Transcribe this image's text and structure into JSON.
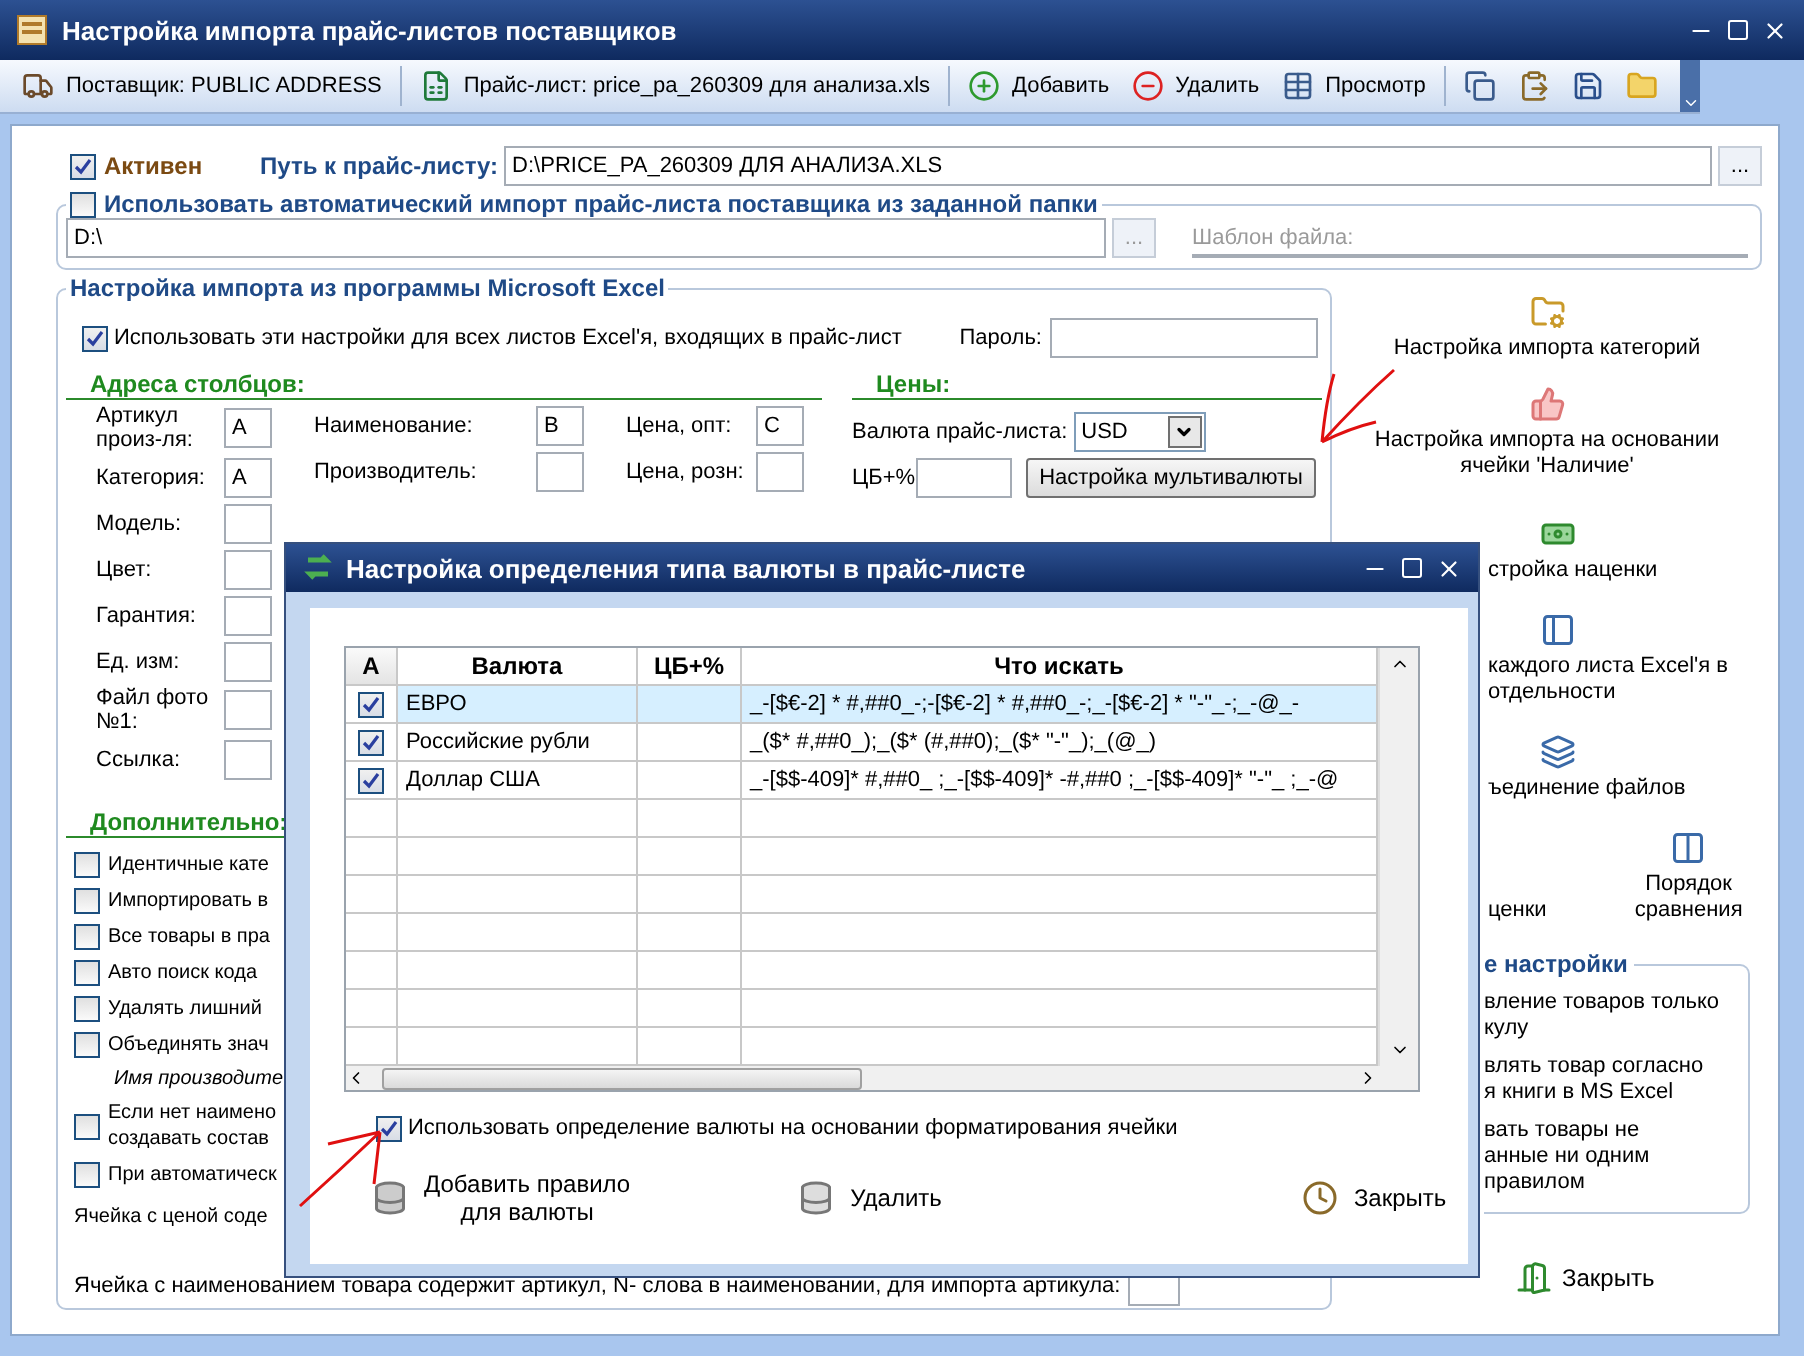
{
  "window": {
    "title": "Настройка импорта прайс-листов поставщиков"
  },
  "toolbar": [
    {
      "kind": "supplier",
      "label": "Поставщик: PUBLIC ADDRESS"
    },
    {
      "kind": "excel",
      "label": "Прайс-лист: price_pa_260309 для анализа.xls"
    },
    {
      "kind": "add",
      "label": "Добавить"
    },
    {
      "kind": "delete",
      "label": "Удалить"
    },
    {
      "kind": "view",
      "label": "Просмотр"
    },
    {
      "kind": "copy"
    },
    {
      "kind": "paste"
    },
    {
      "kind": "save"
    },
    {
      "kind": "folder"
    }
  ],
  "active": {
    "label": "Активен",
    "checked": true
  },
  "path": {
    "label": "Путь к прайс-листу:",
    "value": "D:\\PRICE_PA_260309 ДЛЯ АНАЛИЗА.XLS",
    "button": "..."
  },
  "auto_import": {
    "label": "Использовать автоматический импорт прайс-листа поставщика из заданной папки",
    "checked": false,
    "folder": "D:\\",
    "button": "...",
    "template_label": "Шаблон файла:"
  },
  "excel": {
    "title": "Настройка импорта из программы Microsoft Excel",
    "all_sheets": {
      "label": "Использовать эти настройки для всех листов Excel'я, входящих в прайс-лист",
      "checked": true
    },
    "password_label": "Пароль:",
    "columns_title": "Адреса столбцов:",
    "address_columns": [
      {
        "fields": [
          {
            "label": "Артикул\nпроиз-ля:",
            "value": "A"
          },
          {
            "label": "Категория:",
            "value": "A"
          },
          {
            "label": "Модель:"
          },
          {
            "label": "Цвет:"
          },
          {
            "label": "Гарантия:"
          },
          {
            "label": "Ед. изм:"
          },
          {
            "label": "Файл фото\n№1:"
          },
          {
            "label": "Ссылка:"
          }
        ]
      },
      {
        "fields": [
          {
            "label": "Наименование:",
            "value": "B"
          },
          {
            "label": "Производитель:"
          }
        ]
      },
      {
        "fields": [
          {
            "label": "Цена, опт:",
            "value": "C"
          },
          {
            "label": "Цена, розн:"
          }
        ]
      }
    ],
    "prices_title": "Цены:",
    "currency_label": "Валюта прайс-листа:",
    "currency": "USD",
    "cb_label": "ЦБ+%",
    "multicurrency_button": "Настройка мультивалюты",
    "extra_title": "Дополнительно:",
    "options": [
      {
        "kind": "check",
        "label": "Идентичные кате",
        "checked": false
      },
      {
        "kind": "check",
        "label": "Импортировать в",
        "checked": false
      },
      {
        "kind": "check",
        "label": "Все товары в пра",
        "checked": false
      },
      {
        "kind": "check",
        "label": "Авто поиск кода",
        "checked": false
      },
      {
        "kind": "check",
        "label": "Удалять лишний",
        "checked": false
      },
      {
        "kind": "check",
        "label": "Объединять знач",
        "checked": false
      },
      {
        "kind": "note",
        "label": "Имя производите"
      },
      {
        "kind": "check",
        "label": "Если нет наимено\nсоздавать состав",
        "checked": false
      },
      {
        "kind": "check",
        "label": "При автоматическ",
        "checked": false
      },
      {
        "kind": "text",
        "label": "Ячейка с ценой соде"
      }
    ],
    "article_cell_label": "Ячейка с наименованием товара содержит артикул, N- слова в наименовании, для импорта артикула:"
  },
  "actions": [
    {
      "kind": "category",
      "label": "Настройка импорта категорий"
    },
    {
      "kind": "thumb",
      "label": "Настройка импорта на основании\nячейки 'Наличие'"
    }
  ],
  "actions_partial": [
    {
      "kind": "money",
      "label": "стройка наценки"
    },
    {
      "kind": "sheet",
      "label": "каждого листа Excel'я в\nотдельности"
    },
    {
      "kind": "merge",
      "label": "ъединение файлов"
    }
  ],
  "action_row": [
    {
      "kind": "none",
      "label": "ценки"
    },
    {
      "kind": "compare",
      "label": "Порядок\nсравнения"
    }
  ],
  "other_settings": {
    "title": "е настройки",
    "items": [
      "вление товаров только\nкулу",
      "влять товар согласно\nя книги в MS Excel",
      "вать товары не\nанные ни одним правилом"
    ]
  },
  "close_button": "Закрыть",
  "dialog": {
    "title": "Настройка определения типа валюты в прайс-листе",
    "columns": [
      "А",
      "Валюта",
      "ЦБ+%",
      "Что искать"
    ],
    "rows": [
      {
        "checked": true,
        "selected": true,
        "currency": "ЕВРО",
        "pattern": "_-[$€-2] * #,##0_-;-[$€-2] * #,##0_-;_-[$€-2] * \"-\"_-;_-@_-"
      },
      {
        "checked": true,
        "selected": false,
        "currency": "Российские рубли",
        "pattern": "_($* #,##0_);_($* (#,##0);_($* \"-\"_);_(@_)"
      },
      {
        "checked": true,
        "selected": false,
        "currency": "Доллар США",
        "pattern": "_-[$$-409]* #,##0_ ;_-[$$-409]* -#,##0 ;_-[$$-409]* \"-\"_ ;_-@"
      }
    ],
    "format_option": {
      "label": "Использовать определение валюты на основании форматирования ячейки",
      "checked": true
    },
    "buttons": [
      {
        "kind": "add",
        "label": "Добавить правило\nдля валюты"
      },
      {
        "kind": "delete",
        "label": "Удалить"
      },
      {
        "kind": "close",
        "label": "Закрыть"
      }
    ]
  }
}
